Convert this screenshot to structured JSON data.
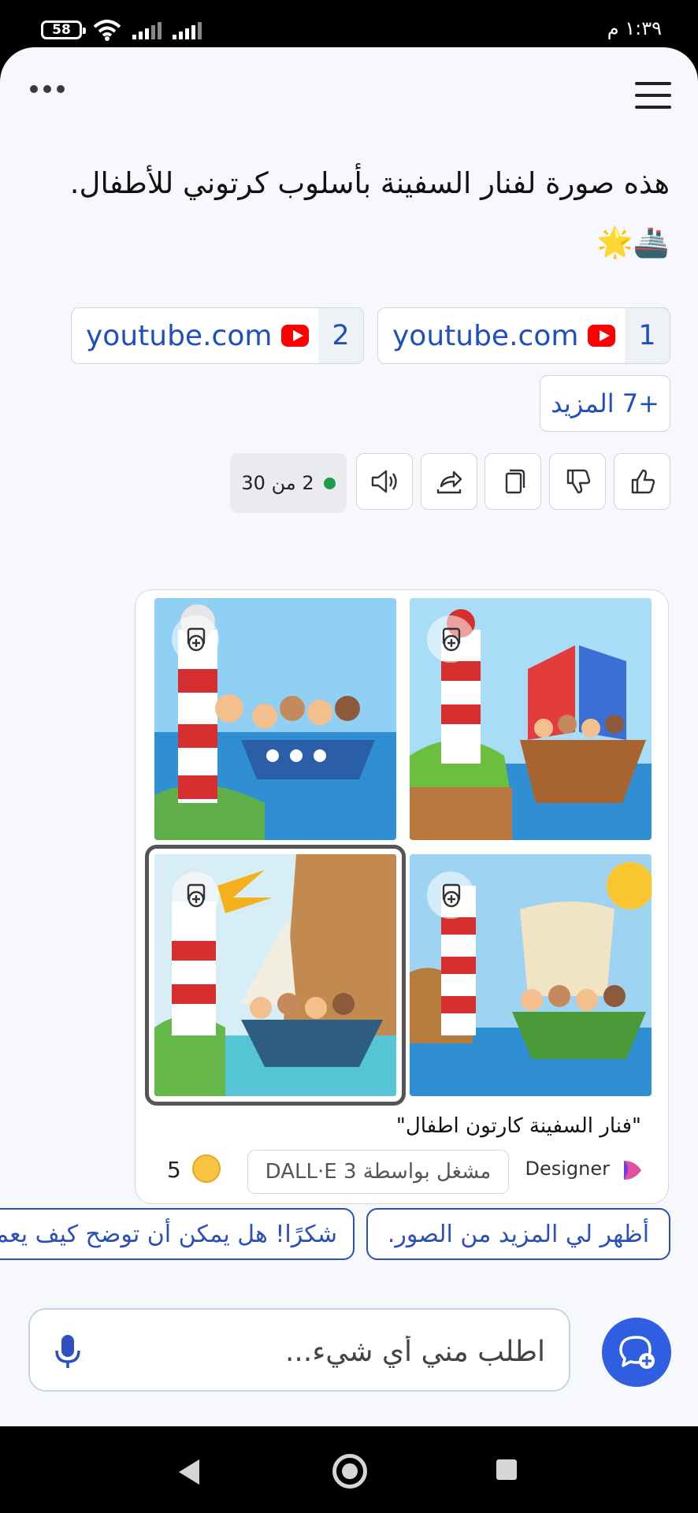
{
  "status_bar": {
    "time": "١:٣٩ م",
    "battery": "58"
  },
  "message": {
    "text": "هذه صورة لفنار السفينة بأسلوب كرتوني للأطفال. 🚢🌟"
  },
  "sources": [
    {
      "number": "1",
      "domain": "youtube.com"
    },
    {
      "number": "2",
      "domain": "youtube.com"
    }
  ],
  "more_sources": {
    "label": "+7 المزيد"
  },
  "actions": {
    "like": "thumbs-up-icon",
    "dislike": "thumbs-down-icon",
    "copy": "copy-icon",
    "share": "share-icon",
    "read_aloud": "speaker-icon"
  },
  "counter": {
    "text": "2 من 30"
  },
  "image_card": {
    "prompt": "\"فنار السفينة كارتون اطفال\"",
    "designer_label": "Designer",
    "powered_by": "مشغل بواسطة DALL·E 3",
    "boosts": "5"
  },
  "suggestions": [
    {
      "label": "أظهر لي المزيد من الصور."
    },
    {
      "label": "شكرًا! هل يمكن أن توضح كيف يعمل"
    }
  ],
  "composer": {
    "placeholder": "اطلب مني أي شيء..."
  },
  "colors": {
    "link_blue": "#1f4fbf",
    "accent_blue": "#2f5ee0",
    "youtube_red": "#ff0000",
    "status_green": "#1e9e4a"
  }
}
